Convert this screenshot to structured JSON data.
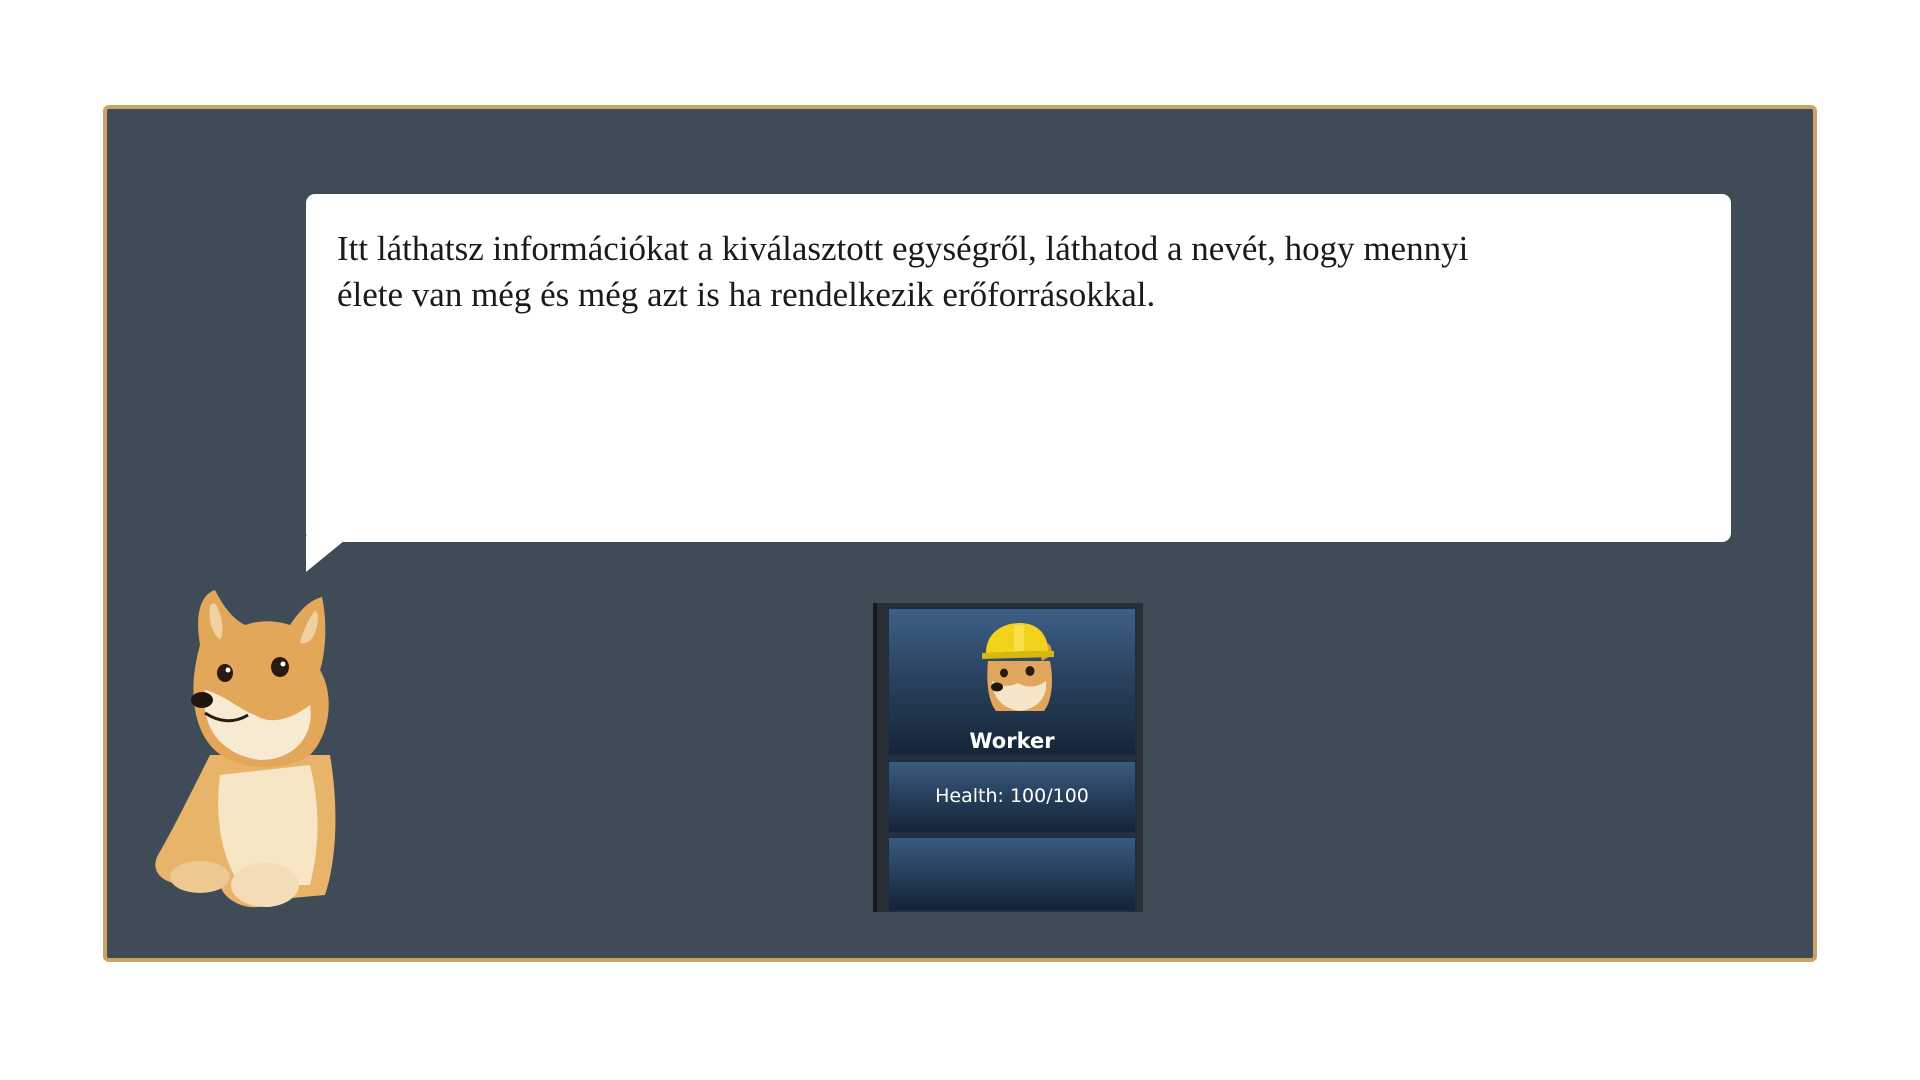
{
  "tutorial": {
    "message_line1": "Itt láthatsz információkat a kiválasztott egységről, láthatod a nevét, hogy mennyi",
    "message_line2": "élete van még és még azt is ha rendelkezik erőforrásokkal."
  },
  "unit_card": {
    "name": "Worker",
    "health_text": "Health: 100/100",
    "portrait_icon": "worker-doge-hardhat-icon"
  },
  "narrator": {
    "icon": "doge-icon"
  },
  "colors": {
    "panel_bg": "#3f4b56",
    "panel_border": "#c9a463",
    "card_blue": "#2b4360"
  }
}
